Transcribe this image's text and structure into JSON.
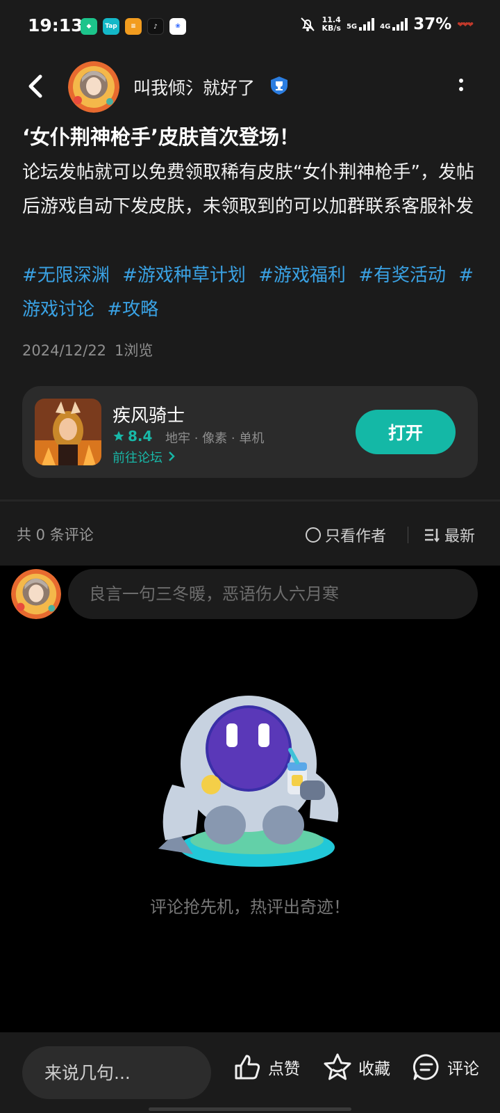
{
  "status_bar": {
    "time": "19:13",
    "speed_value": "11.4",
    "speed_unit": "KB/s",
    "net_1": "5G",
    "net_2": "4G",
    "battery": "37%"
  },
  "header": {
    "username": "叫我倾氵就好了",
    "badge_icon": "trophy-badge-icon"
  },
  "post": {
    "title": "‘女仆荆神枪手’皮肤首次登场！",
    "body": "论坛发帖就可以免费领取稀有皮肤“女仆荆神枪手”，发帖后游戏自动下发皮肤，未领取到的可以加群联系客服补发",
    "tags": [
      "#无限深渊",
      "#游戏种草计划",
      "#游戏福利",
      "#有奖活动",
      "#游戏讨论",
      "#攻略"
    ],
    "date": "2024/12/22",
    "views": "1浏览"
  },
  "game_card": {
    "name": "疾风骑士",
    "rating": "8.4",
    "genre": "地牢 · 像素 · 单机",
    "forum_link": "前往论坛",
    "open_label": "打开"
  },
  "comments": {
    "count_label": "共 0 条评论",
    "author_only_label": "只看作者",
    "sort_label": "最新",
    "input_placeholder": "良言一句三冬暖，恶语伤人六月寒",
    "empty_text": "评论抢先机，热评出奇迹！"
  },
  "bottom_bar": {
    "reply_placeholder": "来说几句...",
    "like_label": "点赞",
    "favorite_label": "收藏",
    "comment_label": "评论"
  },
  "colors": {
    "accent": "#14b8a6",
    "tag": "#3aa2e4",
    "background": "#1b1b1b"
  }
}
